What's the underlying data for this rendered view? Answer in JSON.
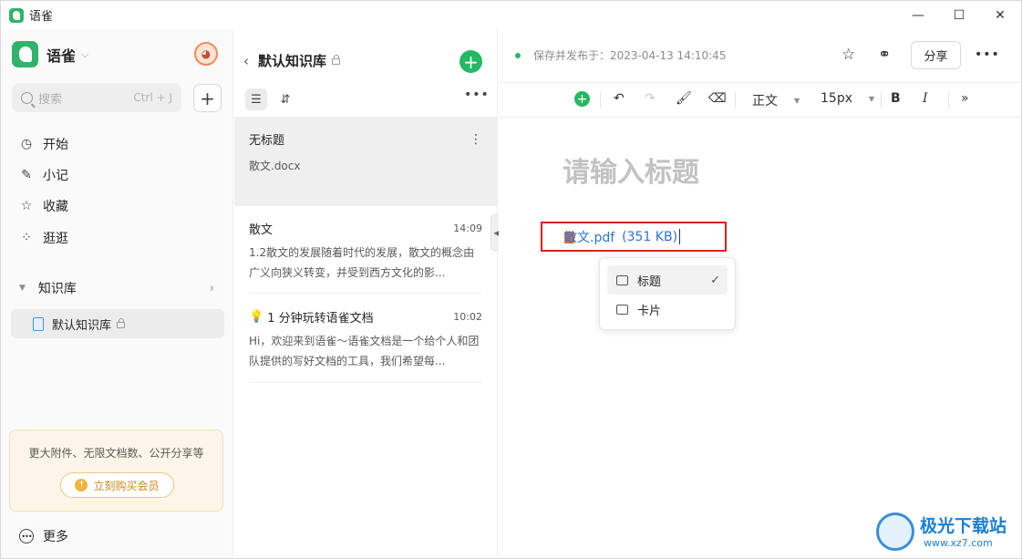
{
  "window": {
    "title": "语雀",
    "minimize": "—",
    "maximize": "☐",
    "close": "✕"
  },
  "sidebar": {
    "brand": "语雀",
    "avatar": "◕",
    "search": {
      "placeholder": "搜索",
      "shortcut": "Ctrl + J"
    },
    "add": "+",
    "nav": [
      {
        "label": "开始",
        "icon": "clock-icon"
      },
      {
        "label": "小记",
        "icon": "feather-icon"
      },
      {
        "label": "收藏",
        "icon": "star-icon"
      },
      {
        "label": "逛逛",
        "icon": "grid-icon"
      }
    ],
    "kb_section": "知识库",
    "kb_item": "默认知识库",
    "promo": {
      "text": "更大附件、无限文档数、公开分享等",
      "button": "立刻购买会员"
    },
    "more": "更多"
  },
  "list": {
    "title": "默认知识库",
    "docs": [
      {
        "title": "无标题",
        "snippet": "散文.docx",
        "time": ""
      },
      {
        "title": "散文",
        "snippet": "1.2散文的发展随着时代的发展，散文的概念由广义向狭义转变，并受到西方文化的影...",
        "time": "14:09"
      },
      {
        "title": "1 分钟玩转语雀文档",
        "snippet": "Hi，欢迎来到语雀～语雀文档是一个给个人和团队提供的写好文档的工具，我们希望每...",
        "time": "10:02"
      }
    ]
  },
  "editor": {
    "status": "保存并发布于：2023-04-13 14:10:45",
    "share": "分享",
    "toolbar": {
      "style": "正文",
      "size": "15px",
      "bold": "B",
      "italic": "I"
    },
    "title_placeholder": "请输入标题",
    "attachment": {
      "name": "散文.pdf",
      "size": "(351 KB)"
    },
    "menu": [
      {
        "label": "标题",
        "checked": "✓"
      },
      {
        "label": "卡片",
        "checked": ""
      }
    ]
  },
  "watermark": {
    "name": "极光下载站",
    "url": "www.xz7.com"
  }
}
